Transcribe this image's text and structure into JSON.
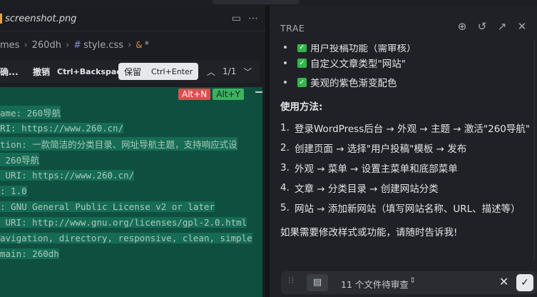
{
  "editor": {
    "tab_title": "screenshot.png",
    "breadcrumb": [
      "mes",
      "260dh",
      "style.css",
      "*"
    ],
    "diffbar": {
      "accept_partial": "确...",
      "undo_label": "撤销",
      "undo_shortcut": "Ctrl+Backspace",
      "keep_label": "保留",
      "keep_shortcut": "Ctrl+Enter",
      "counter": "1/1"
    },
    "badges": {
      "reject": "Alt+N",
      "accept": "Alt+Y"
    },
    "code_lines": [
      "ame: 260导航",
      "RI: https://www.260.cn/",
      "tion: 一款简洁的分类目录、网址导航主题，支持响应式设",
      " 260导航",
      " URI: https://www.260.cn/",
      ": 1.0",
      ": GNU General Public License v2 or later",
      " URI: http://www.gnu.org/licenses/gpl-2.0.html",
      "avigation, directory, responsive, clean, simple",
      "main: 260dh"
    ]
  },
  "panel": {
    "title": "TRAE",
    "partial_item": "用户投稿功能（需审核）",
    "features": [
      "自定义文章类型\"网站\"",
      "美观的紫色渐变配色"
    ],
    "usage_title": "使用方法:",
    "steps": [
      {
        "num": "1.",
        "text": "登录WordPress后台 → 外观 → 主题 → 激活\"260导航\""
      },
      {
        "num": "2.",
        "text": "创建页面 → 选择\"用户投稿\"模板 → 发布"
      },
      {
        "num": "3.",
        "text": "外观 → 菜单 → 设置主菜单和底部菜单"
      },
      {
        "num": "4.",
        "text": "文章 → 分类目录 → 创建网站分类"
      },
      {
        "num": "5.",
        "text": "网站 → 添加新网站（填写网站名称、URL、描述等）"
      }
    ],
    "closing": "如果需要修改样式或功能，请随时告诉我!",
    "review": {
      "pending_text": "11 个文件待审查"
    }
  }
}
